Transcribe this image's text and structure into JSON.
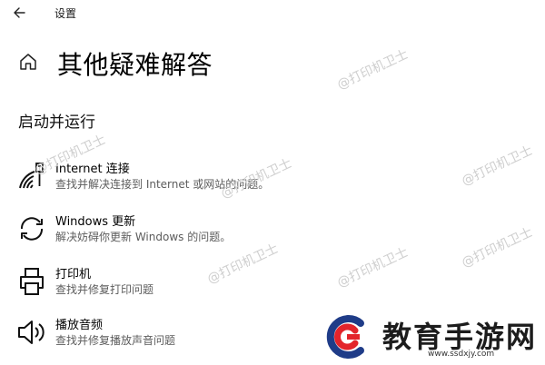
{
  "window": {
    "title": "设置"
  },
  "page": {
    "title": "其他疑难解答"
  },
  "section": {
    "title": "启动并运行"
  },
  "items": [
    {
      "name": "Internet 连接",
      "desc": "查找并解决连接到 Internet 或网站的问题。",
      "icon": "wifi-ethernet-icon"
    },
    {
      "name": "Windows 更新",
      "desc": "解决妨碍你更新 Windows 的问题。",
      "icon": "sync-icon"
    },
    {
      "name": "打印机",
      "desc": "查找并修复打印问题",
      "icon": "printer-icon"
    },
    {
      "name": "播放音频",
      "desc": "查找并修复播放声音问题",
      "icon": "speaker-icon"
    }
  ],
  "watermark": {
    "text": "@打印机卫士"
  },
  "brand": {
    "name": "教育手游网",
    "url": "www.ssdxjy.com",
    "colors": {
      "red": "#e3242b",
      "blue": "#1f3c88"
    }
  }
}
